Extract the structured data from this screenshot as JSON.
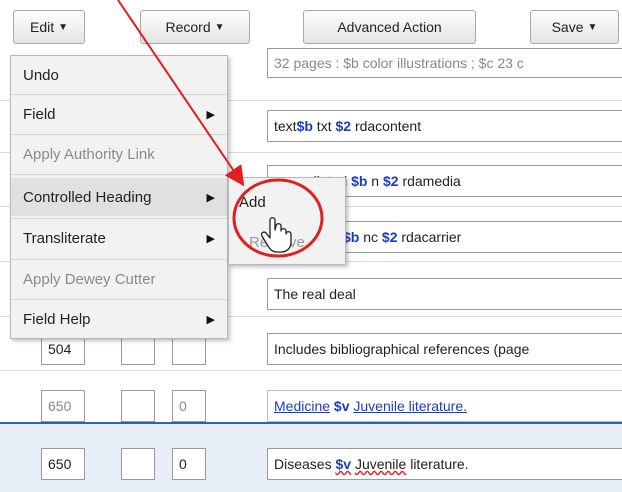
{
  "toolbar": {
    "edit_label": "Edit",
    "record_label": "Record",
    "advanced_label": "Advanced Action",
    "save_label": "Save"
  },
  "rows": {
    "row0_content": "32 pages : $b color illustrations ; $c 23 c",
    "row1": {
      "pre": "text ",
      "sf1": "$b",
      "mid": " txt ",
      "sf2": "$2",
      "post": " rdacontent"
    },
    "row2": {
      "pre": "unmediated ",
      "sf1": "$b",
      "mid": " n ",
      "sf2": "$2",
      "post": " rdamedia"
    },
    "row3": {
      "sf1": "$b",
      "mid": " nc ",
      "sf2": "$2",
      "post": " rdacarrier"
    },
    "row4_content": "The real deal",
    "row5": {
      "code": "504",
      "content": "Includes bibliographical references (page"
    },
    "row6": {
      "code": "650",
      "ind2": "0",
      "link1": "Medicine",
      "sf": "$v",
      "link2": "Juvenile literature."
    },
    "row7": {
      "code": "650",
      "ind2": "0",
      "pre": "Diseases ",
      "sf": "$v",
      "word": "Juvenile",
      "post": " literature."
    }
  },
  "edit_menu": {
    "items": [
      {
        "label": "Undo"
      },
      {
        "label": "Field"
      },
      {
        "label": "Apply Authority Link"
      },
      {
        "label": "Controlled Heading"
      },
      {
        "label": "Transliterate"
      },
      {
        "label": "Apply Dewey Cutter"
      },
      {
        "label": "Field Help"
      }
    ]
  },
  "submenu": {
    "add": "Add",
    "remove": "Remove"
  },
  "colors": {
    "subfield": "#1a3cc4",
    "annotation": "#e02020",
    "selected_row_border": "#2a63b0"
  },
  "icons": [
    "chevron-down-icon",
    "chevron-right-icon",
    "hand-pointer-icon"
  ]
}
